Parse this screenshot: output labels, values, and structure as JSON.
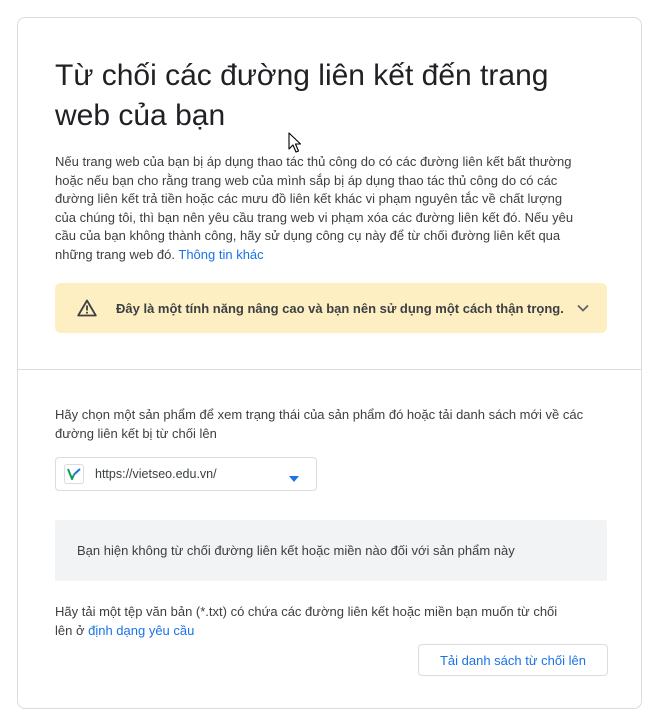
{
  "page": {
    "title": "Từ chối các đường liên kết đến trang web của bạn",
    "description": "Nếu trang web của bạn bị áp dụng thao tác thủ công do có các đường liên kết bất thường hoặc nếu bạn cho rằng trang web của mình sắp bị áp dụng thao tác thủ công do có các đường liên kết trả tiền hoặc các mưu đồ liên kết khác vi phạm nguyên tắc về chất lượng của chúng tôi, thì bạn nên yêu cầu trang web vi phạm xóa các đường liên kết đó. Nếu yêu cầu của bạn không thành công, hãy sử dụng công cụ này để từ chối đường liên kết qua những trang web đó. ",
    "more_info_link": "Thông tin khác"
  },
  "warning": {
    "icon": "warning-triangle-icon",
    "text": "Đây là một tính năng nâng cao và bạn nên sử dụng một cách thận trọng.",
    "expand_icon": "chevron-down-icon"
  },
  "property": {
    "prompt": "Hãy chọn một sản phẩm để xem trạng thái của sản phẩm đó hoặc tải danh sách mới về các đường liên kết bị từ chối lên",
    "selected_url": "https://vietseo.edu.vn/",
    "site_icon": "site-favicon-icon",
    "dropdown_icon": "dropdown-arrow-icon"
  },
  "status": {
    "empty_text": "Bạn hiện không từ chối đường liên kết hoặc miền nào đối với sản phẩm này"
  },
  "upload": {
    "instructions": "Hãy tải một tệp văn bản (*.txt) có chứa các đường liên kết hoặc miền bạn muốn từ chối lên ở ",
    "format_link": "định dạng yêu cầu",
    "button_label": "Tải danh sách từ chối lên"
  },
  "colors": {
    "accent": "#1a73e8",
    "warning_bg": "#feefc3",
    "empty_bg": "#f1f3f4",
    "border": "#dadce0"
  }
}
